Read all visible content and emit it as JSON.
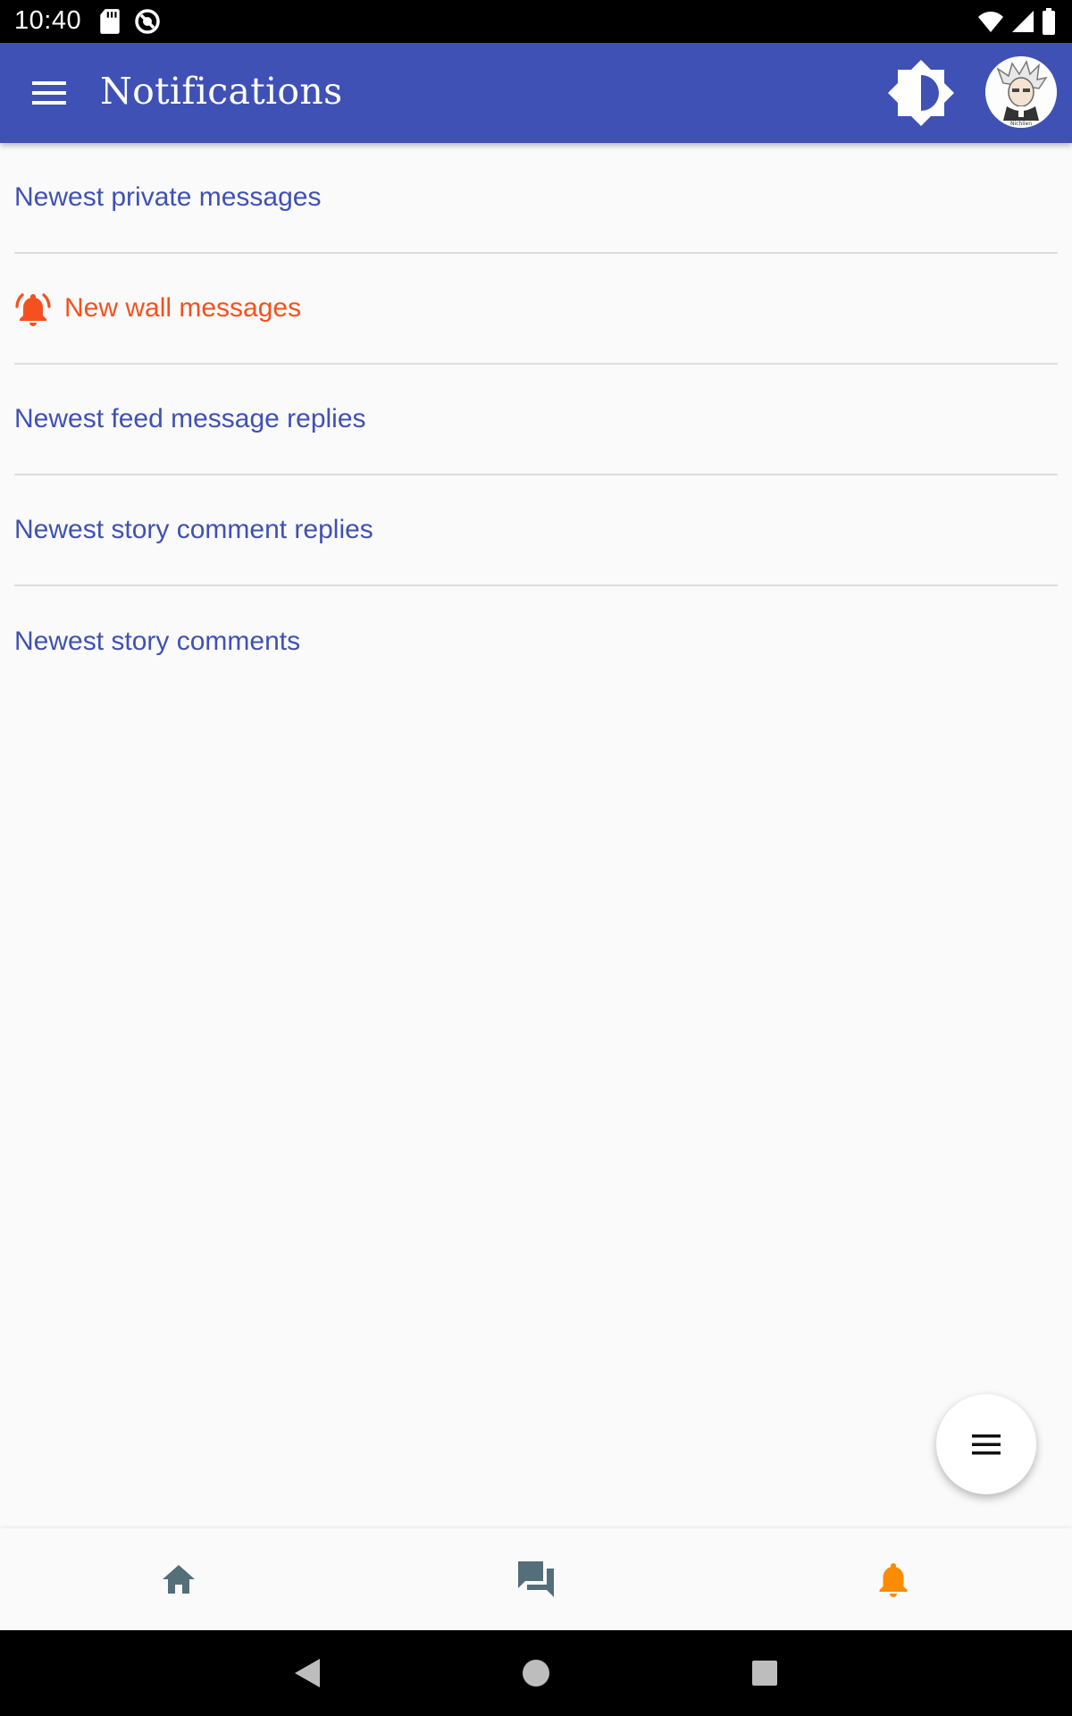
{
  "status_bar": {
    "time": "10:40",
    "icons": [
      "sd-card-icon",
      "do-not-disturb-icon",
      "wifi-icon",
      "signal-icon",
      "battery-icon"
    ]
  },
  "app_bar": {
    "title": "Notifications",
    "menu_icon": "hamburger-menu-icon",
    "brightness_icon": "brightness-icon",
    "avatar_caption": "Nichiien",
    "color": "#3f51b5"
  },
  "notifications": {
    "items": [
      {
        "label": "Newest private messages",
        "alert": false
      },
      {
        "label": "New wall messages",
        "alert": true,
        "icon": "bell-ring-icon"
      },
      {
        "label": "Newest feed message replies",
        "alert": false
      },
      {
        "label": "Newest story comment replies",
        "alert": false
      },
      {
        "label": "Newest story comments",
        "alert": false
      }
    ],
    "link_color": "#3f51b5",
    "alert_color": "#f4511e"
  },
  "fab": {
    "icon": "menu-lines-icon"
  },
  "bottom_nav": {
    "items": [
      {
        "icon": "home-icon",
        "active": false
      },
      {
        "icon": "forum-icon",
        "active": false
      },
      {
        "icon": "bell-icon",
        "active": true
      }
    ],
    "inactive_color": "#546e7a",
    "active_color": "#fb8c00"
  },
  "system_nav": {
    "items": [
      "back-icon",
      "home-circle-icon",
      "recents-icon"
    ]
  }
}
